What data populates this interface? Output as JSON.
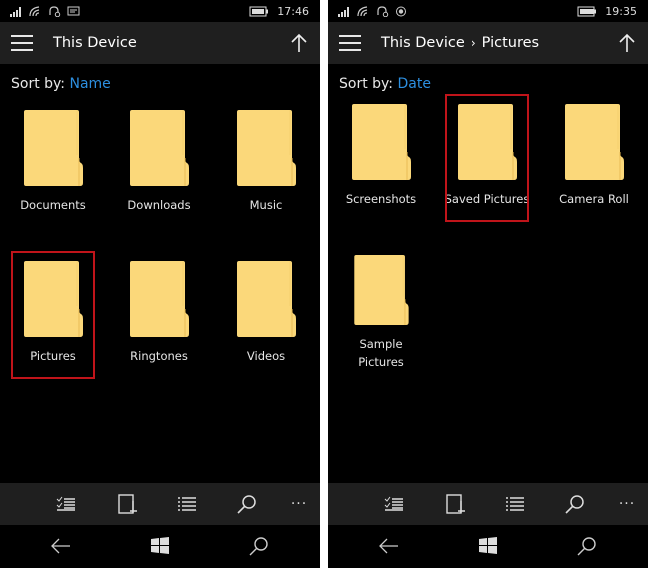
{
  "panes": [
    {
      "status": {
        "time": "17:46",
        "battery": "charging"
      },
      "title": {
        "path": [
          "This Device"
        ]
      },
      "sort": {
        "label": "Sort by:",
        "value": "Name"
      },
      "folders": [
        {
          "name": "Documents",
          "selected": false
        },
        {
          "name": "Downloads",
          "selected": false
        },
        {
          "name": "Music",
          "selected": false
        },
        {
          "name": "Pictures",
          "selected": true
        },
        {
          "name": "Ringtones",
          "selected": false
        },
        {
          "name": "Videos",
          "selected": false
        }
      ]
    },
    {
      "status": {
        "time": "19:35",
        "battery": "full"
      },
      "title": {
        "path": [
          "This Device",
          "Pictures"
        ],
        "separator": "›"
      },
      "sort": {
        "label": "Sort by:",
        "value": "Date"
      },
      "folders": [
        {
          "name": "Screenshots",
          "selected": false
        },
        {
          "name": "Saved Pictures",
          "selected": true
        },
        {
          "name": "Camera Roll",
          "selected": false
        },
        {
          "name": "Sample Pictures",
          "selected": false
        }
      ]
    }
  ],
  "appbar": {
    "icons": [
      "select-icon",
      "new-folder-icon",
      "list-view-icon",
      "search-icon",
      "more-icon"
    ],
    "more_label": "···"
  },
  "colors": {
    "accent": "#2d8fe0",
    "selection": "#c0141a",
    "folder": "#fbd87a",
    "bar": "#1f1f1f"
  }
}
